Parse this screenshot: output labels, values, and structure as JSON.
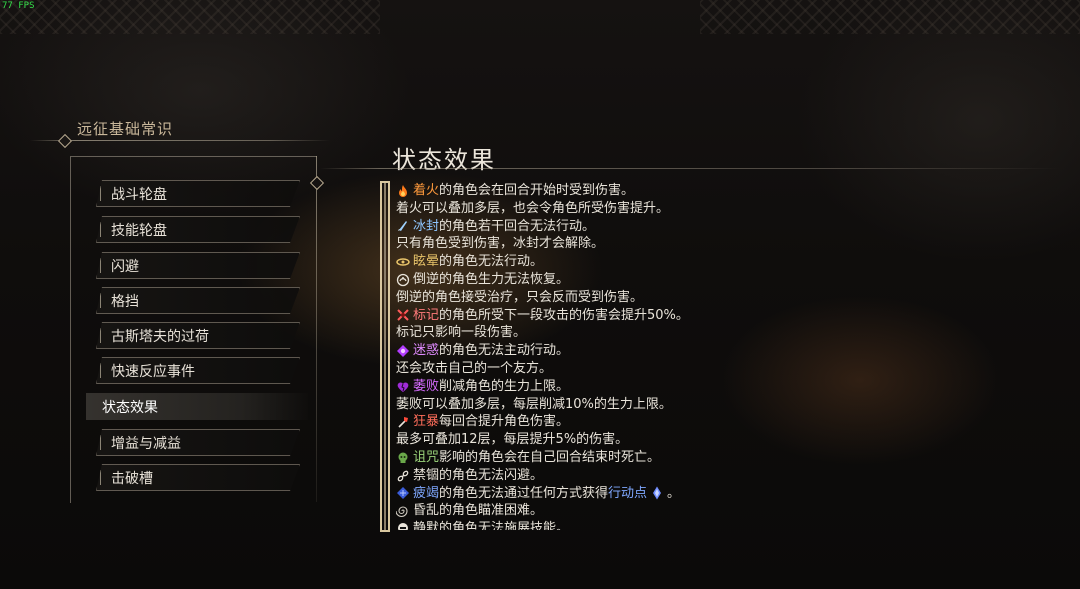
{
  "hud": {
    "fps": "77 FPS"
  },
  "sidebar": {
    "section_title": "远征基础常识",
    "items": [
      {
        "label": "战斗轮盘"
      },
      {
        "label": "技能轮盘"
      },
      {
        "label": "闪避"
      },
      {
        "label": "格挡"
      },
      {
        "label": "古斯塔夫的过荷"
      },
      {
        "label": "快速反应事件"
      },
      {
        "label": "状态效果",
        "active": true
      },
      {
        "label": "增益与减益"
      },
      {
        "label": "击破槽"
      }
    ]
  },
  "content": {
    "title": "状态效果",
    "lines": [
      {
        "icon": "fire-icon",
        "keyword": "着火",
        "text": "的角色会在回合开始时受到伤害。"
      },
      {
        "text": "着火可以叠加多层，也会令角色所受伤害提升。"
      },
      {
        "icon": "ice-icon",
        "keyword": "冰封",
        "text": "的角色若干回合无法行动。"
      },
      {
        "text": "只有角色受到伤害，冰封才会解除。"
      },
      {
        "icon": "daze-icon",
        "keyword": "眩晕",
        "text": "的角色无法行动。"
      },
      {
        "icon": "reversal-icon",
        "keyword": "倒逆",
        "text": "的角色生力无法恢复。"
      },
      {
        "text": "倒逆的角色接受治疗，只会反而受到伤害。"
      },
      {
        "icon": "mark-icon",
        "keyword": "标记",
        "text": "的角色所受下一段攻击的伤害会提升50%。"
      },
      {
        "text": "标记只影响一段伤害。"
      },
      {
        "icon": "confusion-icon",
        "keyword": "迷惑",
        "text": "的角色无法主动行动。"
      },
      {
        "text": "还会攻击自己的一个友方。"
      },
      {
        "icon": "wither-icon",
        "keyword": "萎败",
        "text": "削减角色的生力上限。"
      },
      {
        "text": "萎败可以叠加多层，每层削减10%的生力上限。"
      },
      {
        "icon": "rage-icon",
        "keyword": "狂暴",
        "text": "每回合提升角色伤害。"
      },
      {
        "text": "最多可叠加12层，每层提升5%的伤害。"
      },
      {
        "icon": "curse-icon",
        "keyword": "诅咒",
        "text": "影响的角色会在自己回合结束时死亡。"
      },
      {
        "icon": "shackle-icon",
        "keyword": "禁锢",
        "text": "的角色无法闪避。"
      },
      {
        "icon": "exhaust-icon",
        "keyword": "疲竭",
        "text": "的角色无法通过任何方式获得",
        "highlight": "行动点",
        "trail_icon": "action-point-icon",
        "tail": "。"
      },
      {
        "icon": "dizzy-icon",
        "keyword": "昏乱",
        "text": "的角色瞄准困难。"
      },
      {
        "icon": "silence-icon",
        "keyword": "静默",
        "text": "的角色无法施展技能。"
      }
    ]
  },
  "colors": {
    "fire": "#ff9a3c",
    "ice": "#8ec6ff",
    "daze": "#e8c46a",
    "mark": "#ff7a7a",
    "confusion": "#e08aff",
    "wither": "#d76cff",
    "rage": "#ff6e5a",
    "curse": "#9bd47a",
    "exhaust": "#7fa8ff",
    "action_point": "#7fa8ff"
  }
}
